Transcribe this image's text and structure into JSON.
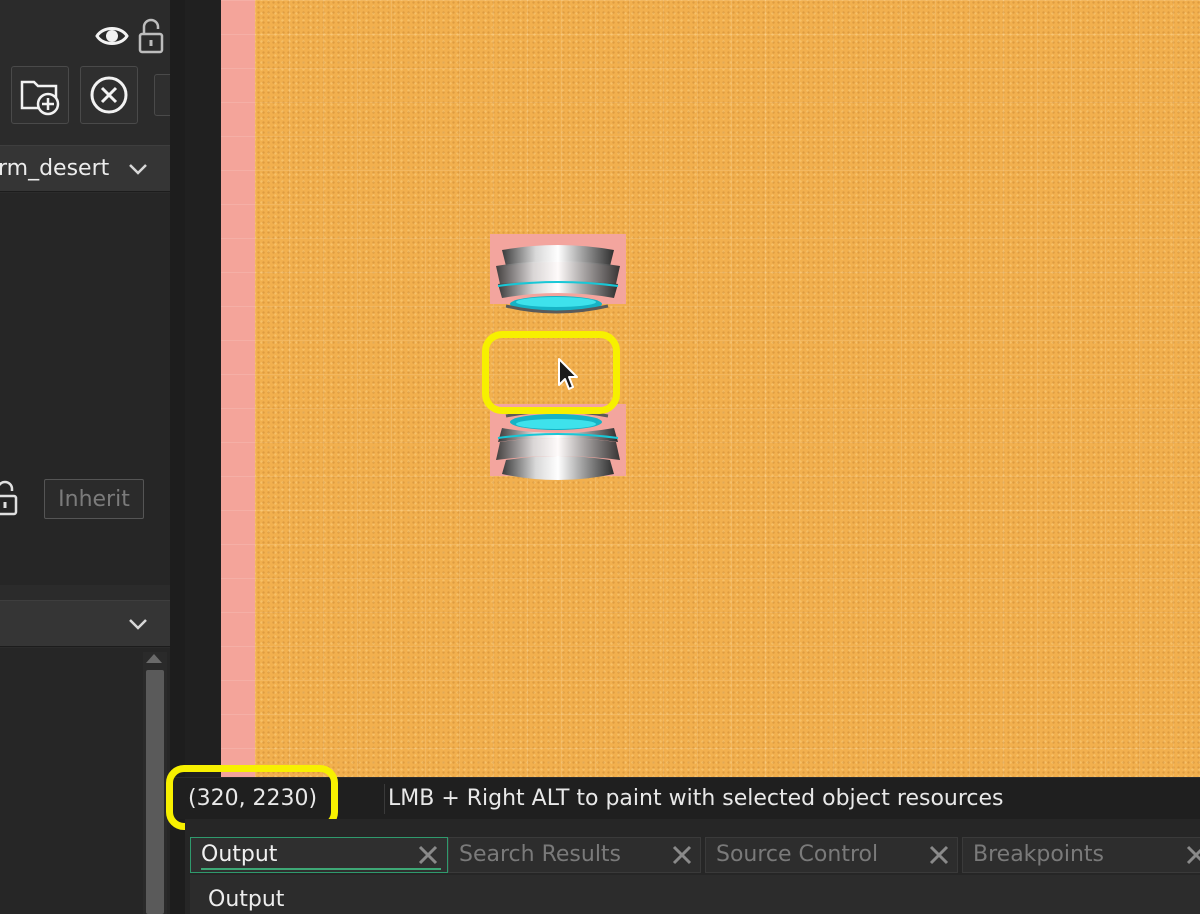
{
  "left_panel": {
    "layer_dropdown_text": "rm_desert",
    "inherit_label": "Inherit"
  },
  "canvas": {
    "background_color": "#f2b04e",
    "border_strip_color": "#f4a49a"
  },
  "status_bar": {
    "coordinates": "(320, 2230)",
    "hint": "LMB + Right ALT to paint with selected object resources"
  },
  "bottom_dock": {
    "tabs": [
      {
        "label": "Output",
        "active": true
      },
      {
        "label": "Search Results",
        "active": false
      },
      {
        "label": "Source Control",
        "active": false
      },
      {
        "label": "Breakpoints",
        "active": false
      }
    ],
    "output_title": "Output"
  },
  "highlight_color": "#f7f000"
}
